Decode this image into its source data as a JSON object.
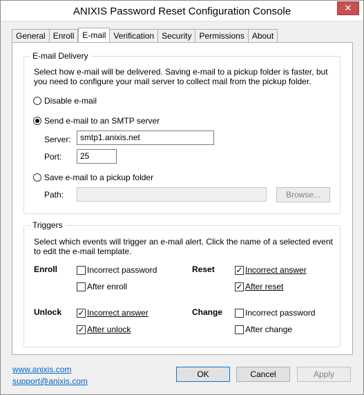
{
  "window": {
    "title": "ANIXIS Password Reset Configuration Console",
    "close_glyph": "✕"
  },
  "tabs": [
    {
      "label": "General"
    },
    {
      "label": "Enroll"
    },
    {
      "label": "E-mail"
    },
    {
      "label": "Verification"
    },
    {
      "label": "Security"
    },
    {
      "label": "Permissions"
    },
    {
      "label": "About"
    }
  ],
  "active_tab": "E-mail",
  "delivery": {
    "title": "E-mail Delivery",
    "description": "Select how e-mail will be delivered. Saving e-mail to a pickup folder is faster, but you need to configure your mail server to collect mail from the pickup folder.",
    "options": [
      {
        "label": "Disable e-mail",
        "checked": false
      },
      {
        "label": "Send e-mail to an SMTP server",
        "checked": true
      },
      {
        "label": "Save e-mail to a pickup folder",
        "checked": false
      }
    ],
    "server_label": "Server:",
    "server_value": "smtp1.anixis.net",
    "port_label": "Port:",
    "port_value": "25",
    "path_label": "Path:",
    "path_value": "",
    "browse_label": "Browse..."
  },
  "triggers": {
    "title": "Triggers",
    "description": "Select which events will trigger an e-mail alert. Click the name of a selected event to edit the e-mail template.",
    "check_glyph": "✓",
    "groups": [
      {
        "name": "Enroll",
        "events": [
          {
            "label": "Incorrect password",
            "checked": false
          },
          {
            "label": "After enroll",
            "checked": false
          }
        ]
      },
      {
        "name": "Reset",
        "events": [
          {
            "label": "Incorrect answer",
            "checked": true
          },
          {
            "label": "After reset",
            "checked": true
          }
        ]
      },
      {
        "name": "Unlock",
        "events": [
          {
            "label": "Incorrect answer",
            "checked": true
          },
          {
            "label": "After unlock",
            "checked": true
          }
        ]
      },
      {
        "name": "Change",
        "events": [
          {
            "label": "Incorrect password",
            "checked": false
          },
          {
            "label": "After change",
            "checked": false
          }
        ]
      }
    ]
  },
  "footer": {
    "website": "www.anixis.com",
    "support": "support@anixis.com",
    "ok_label": "OK",
    "cancel_label": "Cancel",
    "apply_label": "Apply"
  }
}
